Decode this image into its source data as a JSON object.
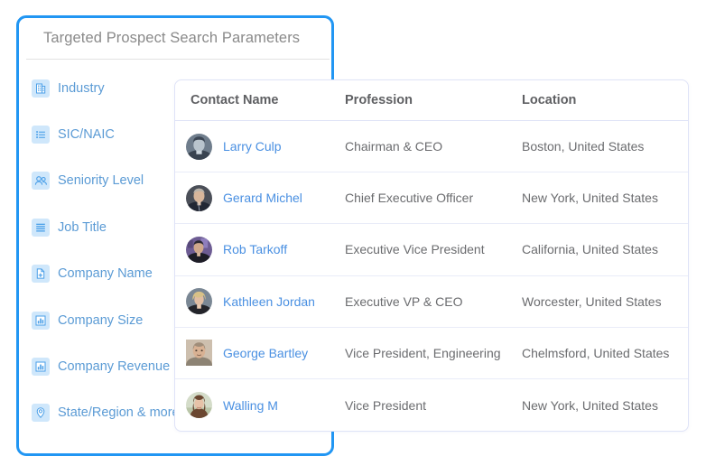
{
  "params_panel": {
    "title": "Targeted Prospect Search Parameters",
    "accent_color": "#2196f3",
    "items": [
      {
        "label": "Industry",
        "icon": "building-icon"
      },
      {
        "label": "SIC/NAIC",
        "icon": "list-icon"
      },
      {
        "label": "Seniority Level",
        "icon": "people-icon"
      },
      {
        "label": "Job Title",
        "icon": "lines-icon"
      },
      {
        "label": "Company Name",
        "icon": "file-plus-icon"
      },
      {
        "label": "Company Size",
        "icon": "bar-chart-icon"
      },
      {
        "label": "Company Revenue",
        "icon": "bar-chart-icon"
      },
      {
        "label": "State/Region & more",
        "icon": "location-pin-icon"
      }
    ]
  },
  "results_table": {
    "columns": [
      "Contact Name",
      "Profession",
      "Location"
    ],
    "rows": [
      {
        "name": "Larry Culp",
        "profession": "Chairman & CEO",
        "location": "Boston, United States",
        "avatar": {
          "shape": "circle",
          "bg": "#6f7d8c",
          "hair": "#3c4654",
          "skin": "#b9c4cd",
          "body": "#394350"
        }
      },
      {
        "name": "Gerard Michel",
        "profession": "Chief Executive Officer",
        "location": "New York, United States",
        "avatar": {
          "shape": "circle",
          "bg": "#4b4f58",
          "hair": "#b9b3aa",
          "skin": "#d8b69b",
          "body": "#222733"
        }
      },
      {
        "name": "Rob Tarkoff",
        "profession": "Executive Vice President",
        "location": "California, United States",
        "avatar": {
          "shape": "circle",
          "bg": "#6d5c93",
          "hair": "#2b2a33",
          "skin": "#cfa88c",
          "body": "#1d1d26"
        }
      },
      {
        "name": "Kathleen Jordan",
        "profession": "Executive VP & CEO",
        "location": "Worcester, United States",
        "avatar": {
          "shape": "circle",
          "bg": "#7a8794",
          "hair": "#d8c187",
          "skin": "#e0bda2",
          "body": "#23242a"
        }
      },
      {
        "name": "George Bartley",
        "profession": "Vice President, Engineering",
        "location": "Chelmsford, United States",
        "avatar": {
          "shape": "square",
          "bg": "#cdbfae",
          "hair": "#a08d79",
          "skin": "#d8b193",
          "body": "#8d8374"
        }
      },
      {
        "name": "Walling M",
        "profession": "Vice President",
        "location": "New York, United States",
        "avatar": {
          "shape": "circle",
          "bg": "#d4dcc9",
          "hair": "#6b4731",
          "skin": "#e6c2a8",
          "body": "#6b4731"
        }
      }
    ]
  }
}
